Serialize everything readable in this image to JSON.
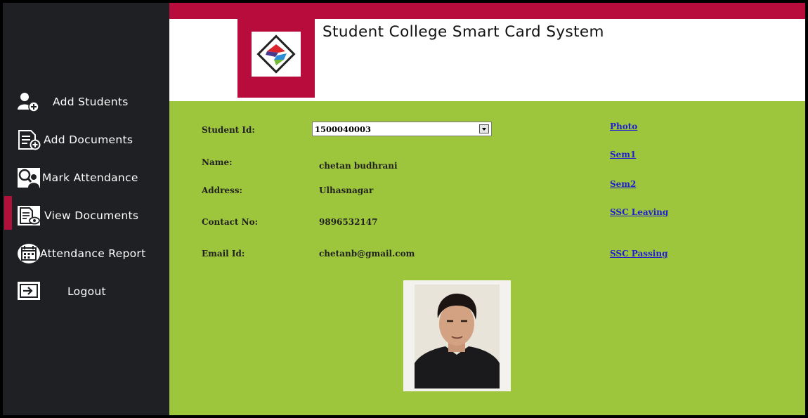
{
  "app": {
    "title": "Student College Smart Card System"
  },
  "sidebar": {
    "items": [
      {
        "label": "Add Students",
        "icon": "add-user-icon"
      },
      {
        "label": "Add Documents",
        "icon": "add-document-icon"
      },
      {
        "label": "Mark Attendance",
        "icon": "mark-attendance-icon"
      },
      {
        "label": "View Documents",
        "icon": "view-documents-icon",
        "active": true
      },
      {
        "label": "Attendance Report",
        "icon": "calendar-icon"
      },
      {
        "label": "Logout",
        "icon": "logout-icon"
      }
    ]
  },
  "form": {
    "student_id_label": "Student Id:",
    "student_id_value": "1500040003",
    "name_label": "Name:",
    "name_value": "chetan budhrani",
    "address_label": "Address:",
    "address_value": "Ulhasnagar",
    "contact_label": "Contact No:",
    "contact_value": "9896532147",
    "email_label": "Email Id:",
    "email_value": "chetanb@gmail.com"
  },
  "documents": {
    "links": [
      "Photo",
      "Sem1",
      "Sem2",
      "SSC Leaving",
      "SSC Passing"
    ]
  },
  "colors": {
    "accent": "#b80c3d",
    "sidebar_bg": "#1f2023",
    "main_bg": "#9dc63c",
    "link": "#1f1fd0"
  }
}
